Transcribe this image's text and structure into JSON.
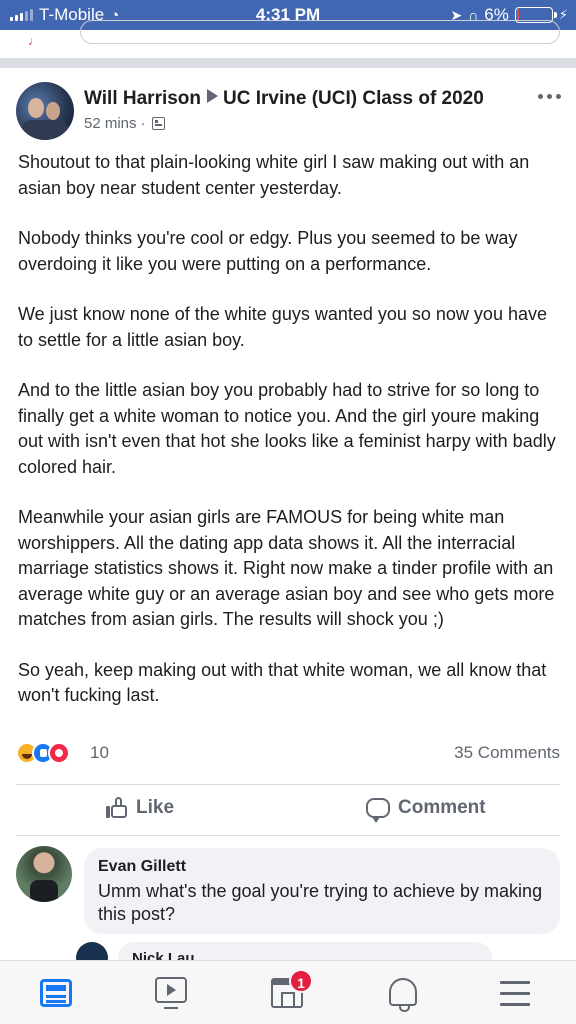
{
  "status_bar": {
    "carrier": "T-Mobile",
    "time": "4:31 PM",
    "battery": "6%",
    "battery_level": 0.06
  },
  "post": {
    "author": "Will Harrison",
    "group": "UC Irvine (UCI) Class of 2020",
    "time_ago": "52 mins",
    "meta_separator": "·",
    "body": [
      "Shoutout to that plain-looking white girl I saw making out with an asian boy near student center yesterday.",
      "Nobody thinks you're cool or edgy. Plus you seemed to be way overdoing it like you were putting on a performance.",
      "We just know none of the white guys wanted you so now you have to settle for a little asian boy.",
      "And to the little asian boy you probably had to strive for so long to finally get a white woman to notice you. And the girl youre making out with isn't even that hot she looks like a feminist harpy with badly colored hair.",
      "Meanwhile your asian girls are FAMOUS for being white man worshippers. All the dating app data shows it. All the interracial marriage statistics shows it. Right now make a tinder profile with an average white guy or an average asian boy and see who gets more matches from asian girls. The results will shock you ;)",
      "So yeah, keep making out with that white woman, we all know that won't fucking last."
    ]
  },
  "reactions": {
    "types": [
      "haha-icon",
      "like-icon",
      "love-icon"
    ],
    "count": "10",
    "comments_count": "35 Comments"
  },
  "actions": {
    "like_label": "Like",
    "comment_label": "Comment"
  },
  "comments": [
    {
      "author": "Evan Gillett",
      "text": "Umm what's the goal you're trying to achieve by making this post?"
    }
  ],
  "reply_preview": {
    "author": "Nick Lau"
  },
  "tab_bar": {
    "icons": [
      "news-feed-icon",
      "watch-icon",
      "marketplace-icon",
      "notifications-icon",
      "menu-icon"
    ],
    "marketplace_badge": "1",
    "active_color": "#1877f2"
  }
}
